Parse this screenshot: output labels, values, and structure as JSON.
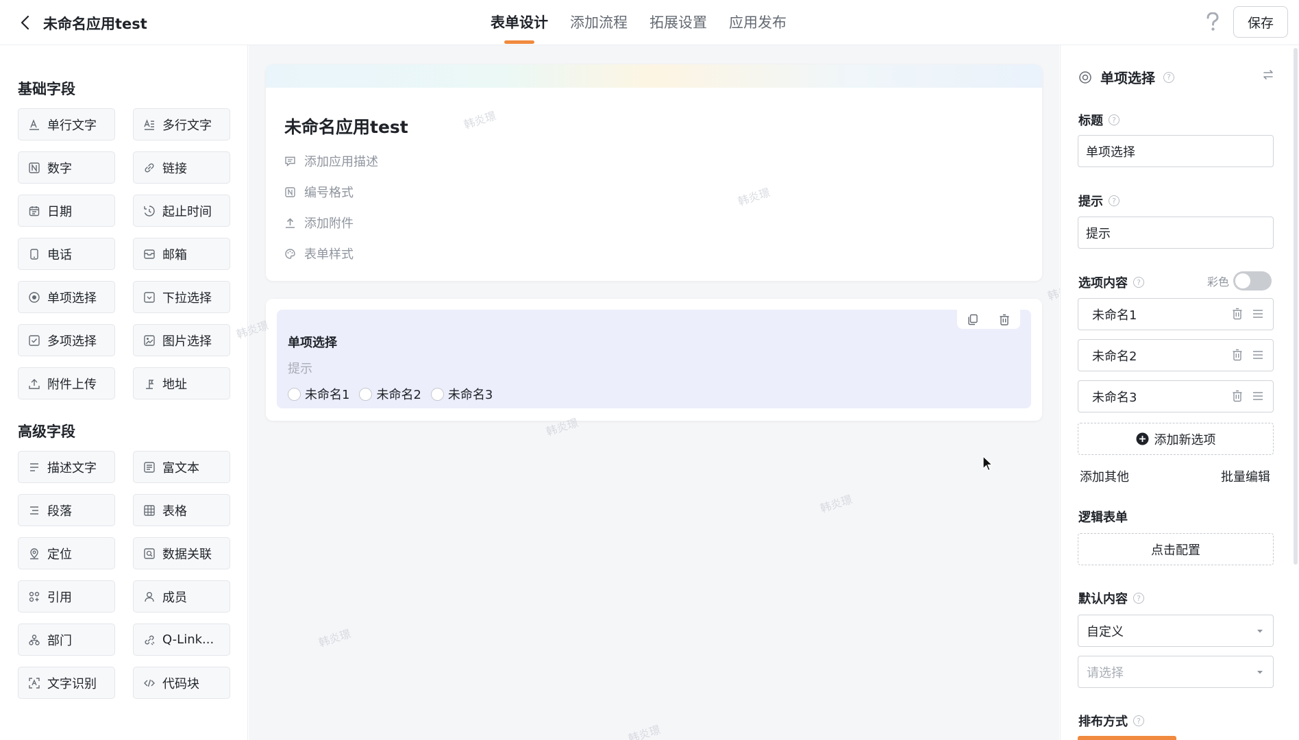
{
  "header": {
    "app_title": "未命名应用test",
    "tabs": [
      {
        "label": "表单设计",
        "active": true
      },
      {
        "label": "添加流程"
      },
      {
        "label": "拓展设置"
      },
      {
        "label": "应用发布"
      }
    ],
    "save_label": "保存",
    "accent_color": "#f08a3e"
  },
  "palette": {
    "basic_title": "基础字段",
    "basic": [
      {
        "label": "单行文字",
        "icon": "text-line-icon"
      },
      {
        "label": "多行文字",
        "icon": "text-multi-icon"
      },
      {
        "label": "数字",
        "icon": "number-icon"
      },
      {
        "label": "链接",
        "icon": "link-icon"
      },
      {
        "label": "日期",
        "icon": "calendar-icon"
      },
      {
        "label": "起止时间",
        "icon": "time-range-icon"
      },
      {
        "label": "电话",
        "icon": "phone-icon"
      },
      {
        "label": "邮箱",
        "icon": "mail-icon"
      },
      {
        "label": "单项选择",
        "icon": "radio-icon"
      },
      {
        "label": "下拉选择",
        "icon": "dropdown-icon"
      },
      {
        "label": "多项选择",
        "icon": "checkbox-icon"
      },
      {
        "label": "图片选择",
        "icon": "image-icon"
      },
      {
        "label": "附件上传",
        "icon": "upload-icon"
      },
      {
        "label": "地址",
        "icon": "address-icon"
      }
    ],
    "advanced_title": "高级字段",
    "advanced": [
      {
        "label": "描述文字",
        "icon": "description-icon"
      },
      {
        "label": "富文本",
        "icon": "rich-text-icon"
      },
      {
        "label": "段落",
        "icon": "paragraph-icon"
      },
      {
        "label": "表格",
        "icon": "table-icon"
      },
      {
        "label": "定位",
        "icon": "location-icon"
      },
      {
        "label": "数据关联",
        "icon": "data-link-icon"
      },
      {
        "label": "引用",
        "icon": "reference-icon"
      },
      {
        "label": "成员",
        "icon": "member-icon"
      },
      {
        "label": "部门",
        "icon": "department-icon"
      },
      {
        "label": "Q-Link...",
        "icon": "q-link-icon"
      },
      {
        "label": "文字识别",
        "icon": "ocr-icon"
      },
      {
        "label": "代码块",
        "icon": "code-icon"
      }
    ]
  },
  "canvas": {
    "form_title": "未命名应用test",
    "meta": [
      {
        "label": "添加应用描述",
        "icon": "comment-icon"
      },
      {
        "label": "编号格式",
        "icon": "number-format-icon"
      },
      {
        "label": "添加附件",
        "icon": "attachment-upload-icon"
      },
      {
        "label": "表单样式",
        "icon": "palette-icon"
      }
    ],
    "field": {
      "label": "单项选择",
      "hint": "提示",
      "options": [
        "未命名1",
        "未命名2",
        "未命名3"
      ]
    },
    "watermark": "韩炎璟"
  },
  "props": {
    "header": "单项选择",
    "title_label": "标题",
    "title_value": "单项选择",
    "hint_label": "提示",
    "hint_value": "提示",
    "options_label": "选项内容",
    "color_label": "彩色",
    "color_on": false,
    "options": [
      "未命名1",
      "未命名2",
      "未命名3"
    ],
    "add_option": "添加新选项",
    "add_other": "添加其他",
    "batch_edit": "批量编辑",
    "logic_label": "逻辑表单",
    "config_label": "点击配置",
    "default_label": "默认内容",
    "default_value": "自定义",
    "default_placeholder": "请选择",
    "layout_label": "排布方式"
  }
}
